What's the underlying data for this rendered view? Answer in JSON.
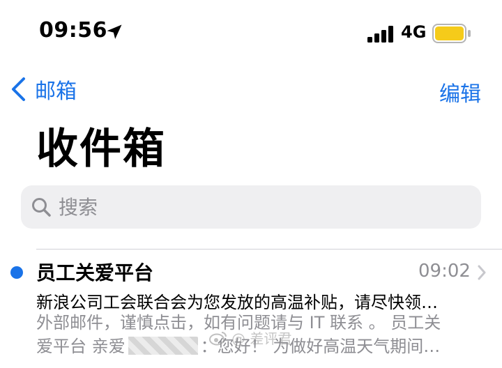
{
  "status_bar": {
    "time": "09:56",
    "network": "4G",
    "battery_color": "#F5CB1A"
  },
  "nav": {
    "back_label": "邮箱",
    "edit_label": "编辑",
    "accent_color": "#1A73E8"
  },
  "page_title": "收件箱",
  "search": {
    "placeholder": "搜索"
  },
  "mail": {
    "sender": "员工关爱平台",
    "time": "09:02",
    "unread": true,
    "subject": "新浪公司工会联合会为您发放的高温补贴，请尽快领…",
    "preview_line1": "外部邮件，谨慎点击，如有问题请与 IT 联系 。 员工关",
    "preview_line2_start": "爱平台 亲爱",
    "preview_line2_end": "：您好！ 为做好高温天气期间…"
  },
  "watermark": "@ 差评君"
}
